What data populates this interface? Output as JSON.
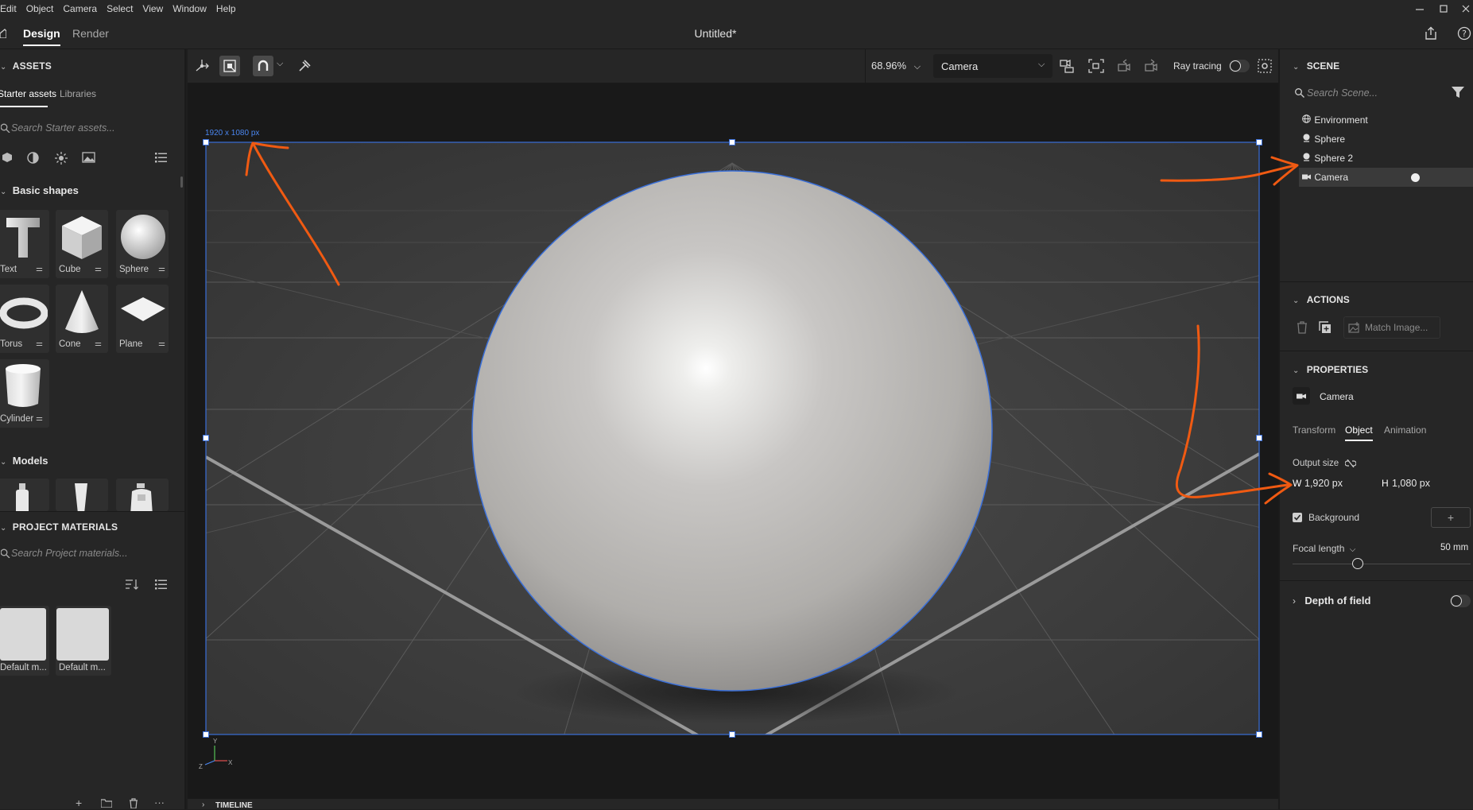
{
  "menu": [
    "Edit",
    "Object",
    "Camera",
    "Select",
    "View",
    "Window",
    "Help"
  ],
  "tabs": {
    "design": "Design",
    "render": "Render"
  },
  "document_title": "Untitled*",
  "assets": {
    "header": "ASSETS",
    "tabs": [
      "Starter assets",
      "Libraries"
    ],
    "search_placeholder": "Search Starter assets...",
    "basic_shapes_header": "Basic shapes",
    "shapes": [
      "Text",
      "Cube",
      "Sphere",
      "Torus",
      "Cone",
      "Plane",
      "Cylinder"
    ],
    "models_header": "Models"
  },
  "project_materials": {
    "header": "PROJECT MATERIALS",
    "search_placeholder": "Search Project materials...",
    "items": [
      "Default m...",
      "Default m..."
    ]
  },
  "toolbar": {
    "zoom": "68.96%",
    "camera_select": "Camera",
    "ray_tracing_label": "Ray tracing"
  },
  "viewport": {
    "canvas_size_label": "1920 x 1080 px",
    "axes": {
      "x": "X",
      "y": "Y",
      "z": "Z"
    }
  },
  "timeline": {
    "label": "TIMELINE"
  },
  "scene": {
    "header": "SCENE",
    "search_placeholder": "Search Scene...",
    "items": [
      "Environment",
      "Sphere",
      "Sphere 2",
      "Camera"
    ],
    "selected": "Camera"
  },
  "actions": {
    "header": "ACTIONS",
    "match_image": "Match Image..."
  },
  "properties": {
    "header": "PROPERTIES",
    "object_name": "Camera",
    "tabs": [
      "Transform",
      "Object",
      "Animation"
    ],
    "active_tab": "Object",
    "output_size_label": "Output size",
    "w_label": "W",
    "w_value": "1,920 px",
    "h_label": "H",
    "h_value": "1,080 px",
    "background_label": "Background",
    "background_checked": true,
    "focal_length_label": "Focal length",
    "focal_length_value": "50 mm",
    "depth_of_field_label": "Depth of field"
  },
  "colors": {
    "accent": "#3a6fd8",
    "annotation": "#f05a12",
    "panel": "#262626",
    "viewport": "#191919"
  }
}
